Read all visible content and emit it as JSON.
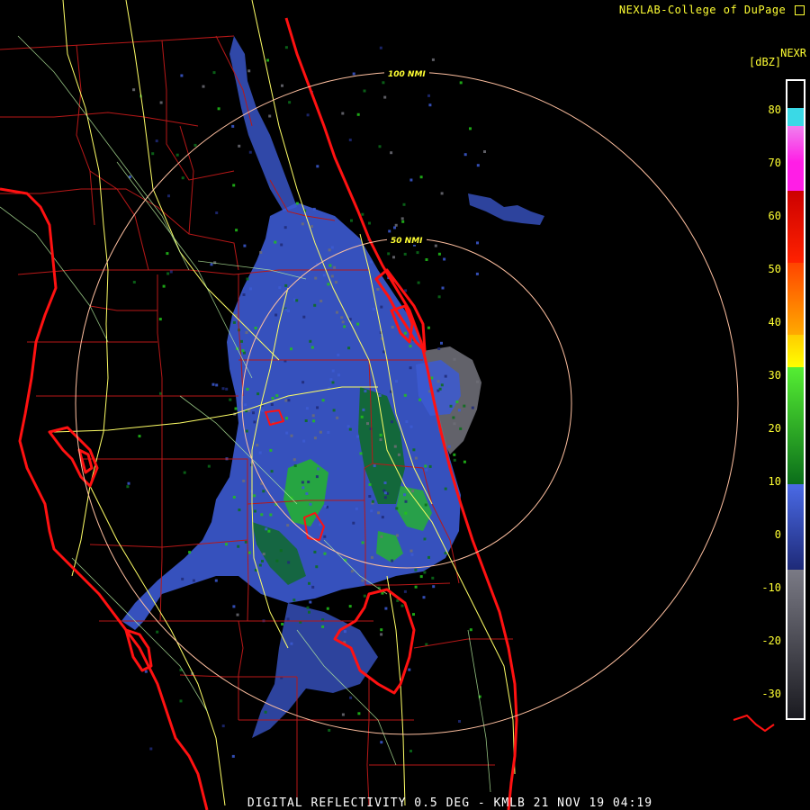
{
  "header": {
    "credit": "NEXLAB-College of DuPage",
    "product": "NEXR",
    "units": "[dBZ]"
  },
  "footer": {
    "caption": "DIGITAL REFLECTIVITY 0.5 DEG - KMLB 21 NOV 19 04:19"
  },
  "range_rings": [
    {
      "label": "50 NMI"
    },
    {
      "label": "100 NMI"
    }
  ],
  "legend": {
    "ticks": [
      "80",
      "70",
      "60",
      "50",
      "40",
      "30",
      "20",
      "10",
      "0",
      "-10",
      "-20",
      "-30"
    ],
    "colors": {
      "cyan": "#3ad9e6",
      "magenta": "#ff1ee6",
      "red": "#ff0000",
      "orange": "#ff8800",
      "yellow": "#ffff00",
      "green": "#22c21a",
      "darkgreen": "#0b6e1a",
      "blue": "#3c5ad2",
      "navy": "#1e2a78",
      "gray": "#6d6d75",
      "darkgray": "#2a2a30"
    }
  },
  "colors": {
    "boundary_state": "#ff1111",
    "boundary_county": "#b81818",
    "roads": "#ffff66",
    "roads_secondary": "#b8f0a0",
    "range_ring": "#ffc0a0"
  }
}
